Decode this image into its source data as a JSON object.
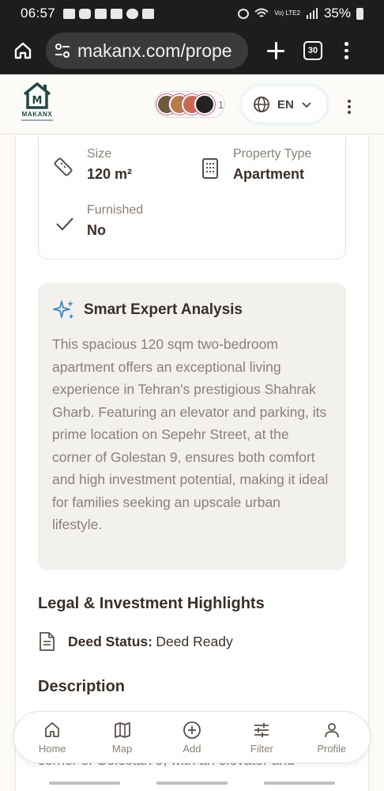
{
  "status_bar": {
    "time": "06:57",
    "battery": "35%",
    "network": "Vo) LTE2"
  },
  "browser": {
    "url": "makanx.com/prope",
    "tab_count": "30"
  },
  "header": {
    "logo_text": "MAKANX",
    "logo_letter": "M",
    "avatar_count": "1",
    "language": "EN"
  },
  "details": {
    "size_label": "Size",
    "size_value": "120 m²",
    "type_label": "Property Type",
    "type_value": "Apartment",
    "furnished_label": "Furnished",
    "furnished_value": "No"
  },
  "analysis": {
    "title": "Smart Expert Analysis",
    "text": "This spacious 120 sqm two-bedroom apartment offers an exceptional living experience in Tehran's prestigious Shahrak Gharb. Featuring an elevator and parking, its prime location on Sepehr Street, at the corner of Golestan 9, ensures both comfort and high investment potential, making it ideal for families seeking an upscale urban lifestyle."
  },
  "legal": {
    "title": "Legal & Investment Highlights",
    "deed_label": "Deed Status:",
    "deed_value": "Deed Ready"
  },
  "description": {
    "title": "Description",
    "partial_text": "corner of Golestan 9, with an elevator and"
  },
  "bottom_nav": {
    "home": "Home",
    "map": "Map",
    "add": "Add",
    "filter": "Filter",
    "profile": "Profile"
  },
  "colors": {
    "accent_teal": "#1f4a45",
    "text_dark": "#3a2f28",
    "text_muted": "#8a7f76",
    "card_bg": "#f3f1ee"
  }
}
